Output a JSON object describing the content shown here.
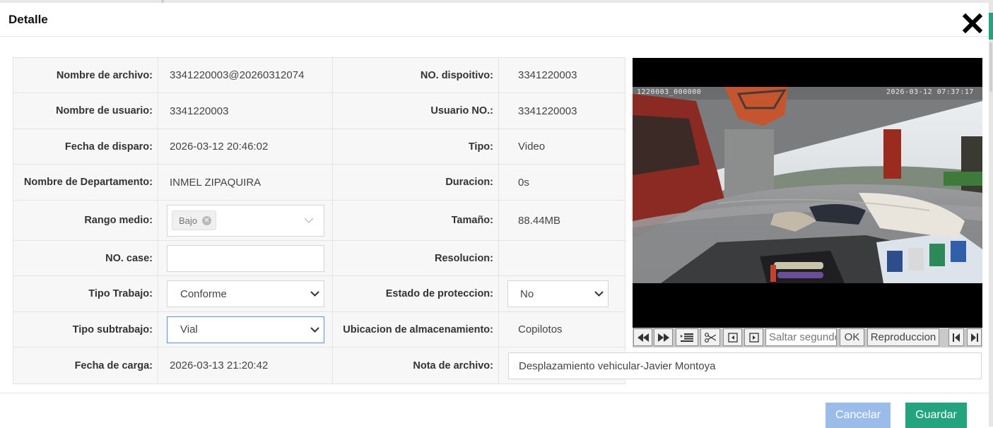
{
  "dialog": {
    "title": "Detalle"
  },
  "form": {
    "file_name": {
      "label": "Nombre de archivo:",
      "value": "3341220003@20260312074"
    },
    "device_no": {
      "label": "NO. dispoitivo:",
      "value": "3341220003"
    },
    "user_name": {
      "label": "Nombre de usuario:",
      "value": "3341220003"
    },
    "user_no": {
      "label": "Usuario NO.:",
      "value": "3341220003"
    },
    "trigger_date": {
      "label": "Fecha de disparo:",
      "value": "2026-03-12 20:46:02"
    },
    "type": {
      "label": "Tipo:",
      "value": "Video"
    },
    "department": {
      "label": "Nombre de Departamento:",
      "value": "INMEL ZIPAQUIRA"
    },
    "duration": {
      "label": "Duracion:",
      "value": "0s"
    },
    "range": {
      "label": "Rango medio:",
      "tag": "Bajo"
    },
    "size": {
      "label": "Tamaño:",
      "value": "88.44MB"
    },
    "case_no": {
      "label": "NO. case:",
      "value": ""
    },
    "resolution": {
      "label": "Resolucion:",
      "value": ""
    },
    "work_type": {
      "label": "Tipo Trabajo:",
      "selected": "Conforme"
    },
    "protection": {
      "label": "Estado de proteccion:",
      "selected": "No"
    },
    "subwork_type": {
      "label": "Tipo subtrabajo:",
      "selected": "Vial"
    },
    "storage": {
      "label": "Ubicacion de almacenamiento:",
      "value": "Copilotos"
    },
    "upload_date": {
      "label": "Fecha de carga:",
      "value": "2026-03-13 21:20:42"
    },
    "file_note": {
      "label": "Nota de archivo:",
      "value": "Desplazamiento vehicular-Javier Montoya"
    }
  },
  "video": {
    "osd_left": "1220003_000000",
    "osd_right": "2026-03-12 07:37:17",
    "controls": {
      "seek_placeholder": "Saltar segundo",
      "ok_label": "OK",
      "playback_label": "Reproduccion"
    }
  },
  "footer": {
    "cancel_label": "Cancelar",
    "save_label": "Guardar"
  },
  "colors": {
    "primary": "#23a47e",
    "cancel": "#9bbce8",
    "active_border": "#5b8fd6"
  }
}
